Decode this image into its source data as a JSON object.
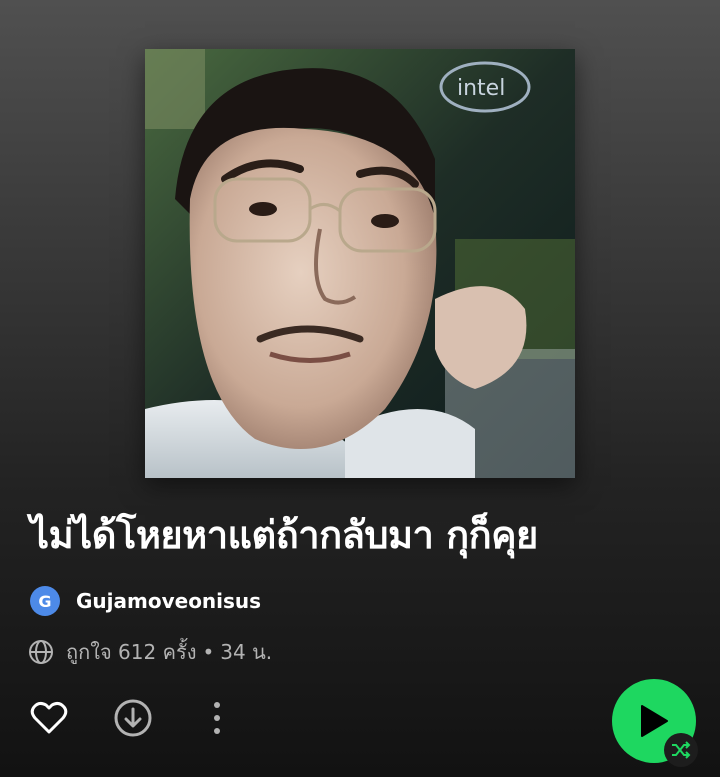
{
  "playlist": {
    "cover_alt": "playlist cover photo",
    "title": "ไม่ได้โหยหาแต่ถ้ากลับมา กุก็คุย",
    "owner": {
      "avatar_letter": "G",
      "name": "Gujamoveonisus",
      "avatar_color": "#4d8ae8"
    },
    "meta": {
      "likes": "ถูกใจ 612 ครั้ง",
      "separator": "•",
      "duration": "34 น."
    }
  },
  "controls": {
    "like_icon": "heart-outline-icon",
    "download_icon": "download-circle-icon",
    "more_icon": "more-vertical-icon",
    "play_icon": "play-icon",
    "shuffle_icon": "shuffle-icon",
    "accent_color": "#1ed760"
  }
}
